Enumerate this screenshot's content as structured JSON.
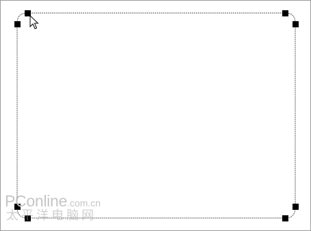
{
  "canvas": {
    "background": "#ffffff",
    "border_color": "#9a9a9a"
  },
  "selection": {
    "shape": "rounded-rectangle",
    "state": "selected",
    "outline_style": "dashed",
    "outline_color": "#555555",
    "handle_color": "#000000",
    "handle_count": 8
  },
  "cursor": {
    "icon": "arrow-pointer-icon"
  },
  "watermark": {
    "logo_main": "PConline",
    "logo_domain": ".com.cn",
    "tagline": "太平洋电脑网"
  }
}
